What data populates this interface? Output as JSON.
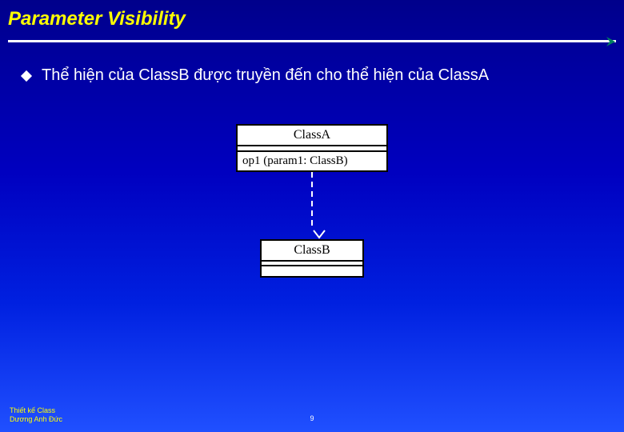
{
  "title": "Parameter Visibility",
  "bullet": "Thể hiện của ClassB được truyền đến cho thể hiện của ClassA",
  "uml": {
    "classA": {
      "name": "ClassA",
      "operation": "op1 (param1: ClassB)"
    },
    "classB": {
      "name": "ClassB"
    }
  },
  "footer": {
    "line1": "Thiết kế Class",
    "line2": "Dương Anh Đức"
  },
  "pagenum": "9"
}
